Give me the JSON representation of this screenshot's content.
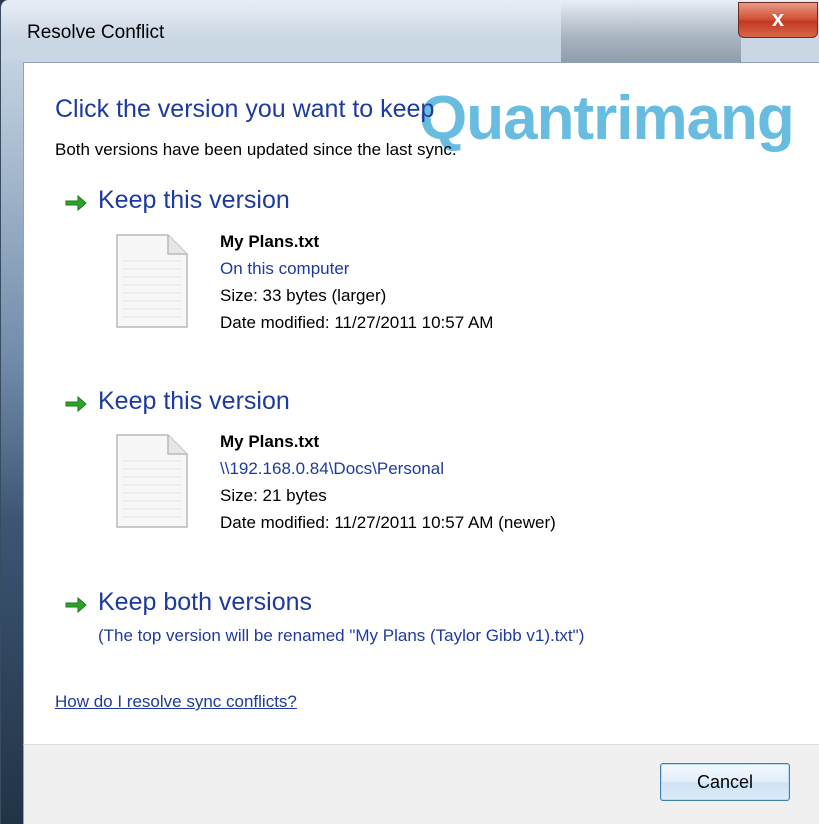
{
  "window": {
    "title": "Resolve Conflict",
    "close_label": "x"
  },
  "watermark": "Quantrimang",
  "header": {
    "heading": "Click the version you want to keep",
    "subheading": "Both versions have been updated since the last sync."
  },
  "options": [
    {
      "title": "Keep this version",
      "file_name": "My Plans.txt",
      "location": "On this computer",
      "size": "Size: 33 bytes (larger)",
      "date": "Date modified: 11/27/2011 10:57 AM"
    },
    {
      "title": "Keep this version",
      "file_name": "My Plans.txt",
      "location": "\\\\192.168.0.84\\Docs\\Personal",
      "size": "Size: 21 bytes",
      "date": "Date modified: 11/27/2011 10:57 AM (newer)"
    }
  ],
  "keep_both": {
    "title": "Keep both versions",
    "note": "(The top version will be renamed \"My Plans (Taylor Gibb v1).txt\")"
  },
  "help_link": "How do I resolve sync conflicts?",
  "footer": {
    "cancel_label": "Cancel"
  },
  "colors": {
    "accent_blue": "#1e3a9e",
    "arrow_green": "#2aa52a",
    "close_red": "#c23a20"
  },
  "icons": {
    "arrow": "green-right-arrow-icon",
    "file": "text-file-icon",
    "close": "close-icon"
  }
}
